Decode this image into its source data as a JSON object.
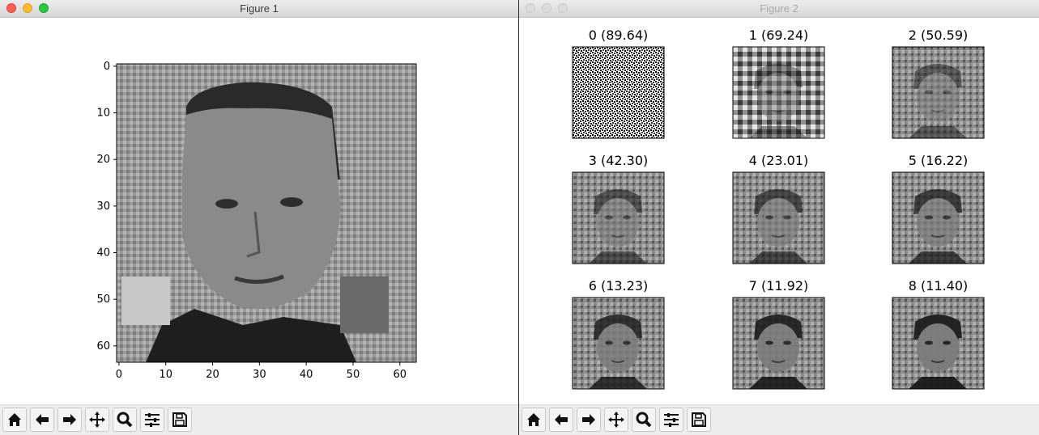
{
  "figure1": {
    "title": "Figure 1",
    "image_alt": "grayscale 64x64 face image",
    "chart_data": {
      "type": "heatmap",
      "title": "",
      "xlabel": "",
      "ylabel": "",
      "xlim": [
        0,
        63
      ],
      "ylim": [
        63,
        0
      ],
      "x_ticks": [
        "0",
        "10",
        "20",
        "30",
        "40",
        "50",
        "60"
      ],
      "y_ticks": [
        "0",
        "10",
        "20",
        "30",
        "40",
        "50",
        "60"
      ],
      "colormap": "gray",
      "grid": false
    }
  },
  "figure2": {
    "title": "Figure 2",
    "chart_data": {
      "type": "heatmap",
      "grid": false,
      "colormap": "gray",
      "panels": [
        {
          "title": "0 (89.64)"
        },
        {
          "title": "1 (69.24)"
        },
        {
          "title": "2 (50.59)"
        },
        {
          "title": "3 (42.30)"
        },
        {
          "title": "4 (23.01)"
        },
        {
          "title": "5 (16.22)"
        },
        {
          "title": "6 (13.23)"
        },
        {
          "title": "7 (11.92)"
        },
        {
          "title": "8 (11.40)"
        }
      ]
    }
  },
  "toolbar": {
    "buttons": [
      "home-icon",
      "back-arrow-icon",
      "forward-arrow-icon",
      "pan-move-icon",
      "zoom-magnifier-icon",
      "configure-subplots-icon",
      "save-floppy-icon"
    ]
  },
  "colors": {
    "close": "#fe5f57",
    "minimize": "#febc2e",
    "zoom": "#28c840",
    "inactive_light": "#dcdcdc"
  }
}
